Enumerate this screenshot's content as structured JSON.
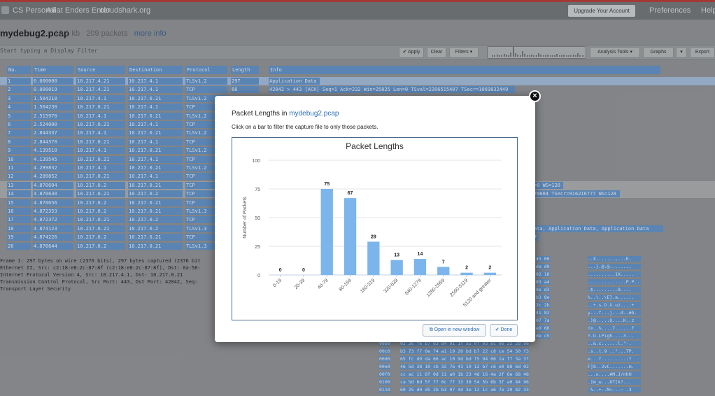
{
  "topbar": {
    "crumbs": [
      "CS Personal",
      "Ailiat Enders Enter",
      "cloudshark.org"
    ],
    "upgrade_label": "Upgrade Your Account",
    "preferences_label": "Preferences",
    "help_label": "Help"
  },
  "file": {
    "name": "mydebug2.pcap",
    "size": "13.1 kb",
    "packets": "209 packets",
    "more_info": "more info"
  },
  "filter": {
    "placeholder": "Start typing a Display Filter",
    "apply_label": "Apply",
    "clear_label": "Clear",
    "filters_label": "Filters",
    "analysis_tools_label": "Analysis Tools",
    "graphs_label": "Graphs",
    "export_label": "Export"
  },
  "packet_table": {
    "columns": [
      "No.",
      "Time",
      "Source",
      "Destination",
      "Protocol",
      "Length",
      "Info"
    ],
    "rows": [
      [
        "1",
        "0.000000",
        "10.217.4.21",
        "10.217.4.1",
        "TLSv1.2",
        "297",
        "Application Data"
      ],
      [
        "2",
        "0.000019",
        "10.217.4.21",
        "10.217.4.1",
        "TCP",
        "66",
        "42042 > 443 [ACK] Seq=1 Ack=232 Win=25825 Len=0 TSval=2206515407 TSecr=1069832449"
      ],
      [
        "3",
        "1.504210",
        "10.217.4.1",
        "10.217.0.21",
        "TLSv1.2",
        "",
        ""
      ],
      [
        "4",
        "1.504230",
        "10.217.0.21",
        "10.217.4.1",
        "TCP",
        "",
        ""
      ],
      [
        "5",
        "2.515970",
        "10.217.4.1",
        "10.217.0.21",
        "TLSv1.2",
        "",
        ""
      ],
      [
        "6",
        "2.524000",
        "10.217.0.21",
        "10.217.4.1",
        "TCP",
        "",
        ""
      ],
      [
        "7",
        "2.844337",
        "10.217.4.1",
        "10.217.0.21",
        "TLSv1.2",
        "",
        ""
      ],
      [
        "8",
        "2.844370",
        "10.217.0.21",
        "10.217.4.1",
        "TCP",
        "",
        ""
      ],
      [
        "9",
        "4.139510",
        "10.217.4.1",
        "10.217.0.21",
        "TLSv1.2",
        "",
        ""
      ],
      [
        "10",
        "4.139545",
        "10.217.0.21",
        "10.217.4.1",
        "TCP",
        "",
        ""
      ],
      [
        "11",
        "4.289832",
        "10.217.4.1",
        "10.217.0.21",
        "TLSv1.2",
        "",
        ""
      ],
      [
        "12",
        "4.289852",
        "10.217.0.21",
        "10.217.4.1",
        "TCP",
        "",
        ""
      ],
      [
        "13",
        "4.870604",
        "10.217.0.2",
        "10.217.0.21",
        "TCP",
        "",
        "=0 WS=128"
      ],
      [
        "14",
        "4.870630",
        "10.217.0.21",
        "10.217.0.2",
        "TCP",
        "",
        "70604 TSecr=916216777 WS=128"
      ],
      [
        "15",
        "4.870656",
        "10.217.0.2",
        "10.217.0.21",
        "TCP",
        "",
        ""
      ],
      [
        "16",
        "4.872353",
        "10.217.0.2",
        "10.217.0.21",
        "TLSv1.3",
        "",
        ""
      ],
      [
        "17",
        "4.872372",
        "10.217.0.21",
        "10.217.0.2",
        "TCP",
        "",
        ""
      ],
      [
        "18",
        "4.874123",
        "10.217.0.21",
        "10.217.0.2",
        "TLSv1.3",
        "",
        "ata, Application Data, Application Data"
      ],
      [
        "19",
        "4.874226",
        "10.217.0.2",
        "10.217.0.21",
        "TCP",
        "",
        "7"
      ],
      [
        "20",
        "4.876644",
        "10.217.0.2",
        "10.217.0.21",
        "TLSv1.3",
        "",
        ""
      ]
    ]
  },
  "details": [
    "Frame 1: 297 bytes on wire (2376 bits), 297 bytes captured (2376 bit",
    "Ethernet II, Src: c2:18:e8:2c:87:8f (c2:18:e8:2c:87:8f), Dst: 0a:58:",
    "Internet Protocol Version 4, Src: 10.217.4.1, Dst: 10.217.0.21",
    "Transmission Control Protocol, Src Port: 443, Dst Port: 42042, Seq:",
    "Transport Layer Security"
  ],
  "hex_rows": [
    {
      "offset": "",
      "bytes": "45 00",
      "ascii": "..X.......,...E."
    },
    {
      "offset": "",
      "bytes": "da d9",
      "ascii": "...}.@.@........"
    },
    {
      "offset": "",
      "bytes": "02 18",
      "ascii": "..........1X....."
    },
    {
      "offset": "",
      "bytes": "83 a4",
      "ascii": "..............P.P..."
    },
    {
      "offset": "",
      "bytes": "8e d3",
      "ascii": ".$.........8...."
    },
    {
      "offset": "",
      "bytes": "b3 8e",
      "ascii": "%..\\..\\E}.a......"
    },
    {
      "offset": "",
      "bytes": "2c 2b",
      "ascii": "..+.s.D.X.uz....+"
    },
    {
      "offset": "",
      "bytes": "41 82",
      "ascii": "y...f...j...d..#A."
    },
    {
      "offset": "",
      "bytes": "07 7a",
      "ascii": ".)@.....Q....K..z"
    },
    {
      "offset": "",
      "bytes": "e9 66",
      "ascii": "(m..%....7......f"
    },
    {
      "offset": "",
      "bytes": "de c5",
      "ascii": "Y.U.LPigh....3..."
    },
    {
      "offset": "00b0",
      "bytes": "02 26 f6 b7 63 84 91 1f  a5 0f 03 6c 0e 22 2d 9e",
      "ascii": "..&.c......l.\"-."
    },
    {
      "offset": "00c0",
      "bytes": "b3 73 f7 0e 74 a1 19 20  bd b7 22 c8 ce 54 50 f3",
      "ascii": ".s..t.9 ..\".,.TP."
    },
    {
      "offset": "00d0",
      "bytes": "65 fc d9 da 66 ac 10 9d  bd f5 94 06 1a ff 3a 3f",
      "ascii": "e...f.........:?"
    },
    {
      "offset": "00e0",
      "bytes": "46 5d 38 10 cb 32 76 43  10 12 b7 c6 e0 88 6d 02",
      "ascii": "F]8..2vC.......m."
    },
    {
      "offset": "00f0",
      "bytes": "cc ac 11 6f 0d 11 a0 1b  23 4d 16 4a 2f 6e 68 48",
      "ascii": "...o....#M.J/nhH"
    },
    {
      "offset": "0100",
      "bytes": "ca 5d 6d 5f 77 0c 7f 13  38 54 5b 6b 3f a0 84 96",
      "ascii": ".]m_w...8T[k?..."
    },
    {
      "offset": "0110",
      "bytes": "60 25 d0 d5 2b b3 07 4d  3e 12 1c a6 7e 20 82 33",
      "ascii": "`%..+..M>...~ .3"
    }
  ],
  "modal": {
    "title_prefix": "Packet Lengths in",
    "title_file": "mydebug2.pcap",
    "subtitle": "Click on a bar to filter the capture file to only those packets.",
    "open_window_label": "Open in new window",
    "done_label": "Done",
    "close_symbol": "×"
  },
  "chart_data": {
    "type": "bar",
    "title": "Packet Lengths",
    "xlabel": "",
    "ylabel": "Number of Packets",
    "categories": [
      "0-19",
      "20-39",
      "40-79",
      "80-159",
      "160-319",
      "320-639",
      "640-1279",
      "1280-2559",
      "2560-5119",
      "5120 and greater"
    ],
    "values": [
      0,
      0,
      75,
      67,
      29,
      13,
      14,
      7,
      2,
      2
    ],
    "ylim": [
      0,
      100
    ],
    "yticks": [
      0,
      25,
      50,
      75,
      100
    ],
    "bar_color": "#7cb5ec",
    "grid": true,
    "legend": "none"
  },
  "colors": {
    "accent": "#2f6fb5",
    "row_highlight": "#5f8fc4",
    "topline": "#b23a35"
  }
}
